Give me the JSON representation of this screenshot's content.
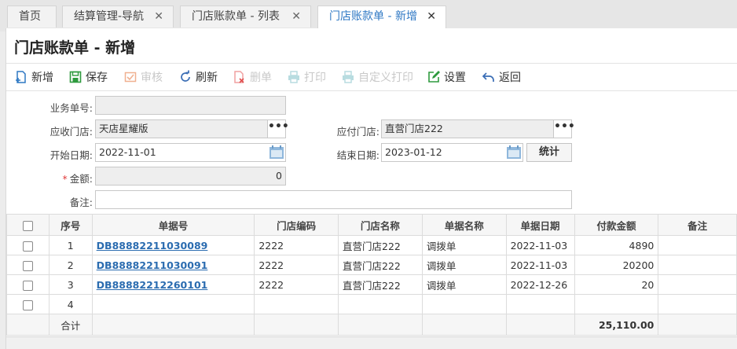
{
  "tabs": [
    {
      "label": "首页",
      "closable": false
    },
    {
      "label": "结算管理-导航",
      "closable": true
    },
    {
      "label": "门店账款单 - 列表",
      "closable": true
    },
    {
      "label": "门店账款单 - 新增",
      "closable": true,
      "active": true
    }
  ],
  "close_glyph": "✕",
  "page_title": "门店账款单 - 新增",
  "toolbar": {
    "add": "新增",
    "save": "保存",
    "audit": "审核",
    "refresh": "刷新",
    "delete": "删单",
    "print": "打印",
    "custom_print": "自定义打印",
    "settings": "设置",
    "back": "返回"
  },
  "form": {
    "business_no_label": "业务单号:",
    "business_no_value": "",
    "receivable_store_label": "应收门店:",
    "receivable_store_value": "天店星耀版",
    "payable_store_label": "应付门店:",
    "payable_store_value": "直营门店222",
    "start_date_label": "开始日期:",
    "start_date_value": "2022-11-01",
    "end_date_label": "结束日期:",
    "end_date_value": "2023-01-12",
    "stats_button": "统计",
    "amount_required": "*",
    "amount_label": "金额:",
    "amount_value": "0",
    "remark_label": "备注:",
    "remark_value": "",
    "lookup_glyph": "•••"
  },
  "table": {
    "headers": {
      "seq": "序号",
      "doc_no": "单据号",
      "store_code": "门店编码",
      "store_name": "门店名称",
      "doc_name": "单据名称",
      "doc_date": "单据日期",
      "pay_amount": "付款金额",
      "remark": "备注"
    },
    "rows": [
      {
        "seq": "1",
        "doc_no": "DB88882211030089",
        "store_code": "2222",
        "store_name": "直营门店222",
        "doc_name": "调拨单",
        "doc_date": "2022-11-03",
        "pay_amount": "4890",
        "remark": ""
      },
      {
        "seq": "2",
        "doc_no": "DB88882211030091",
        "store_code": "2222",
        "store_name": "直营门店222",
        "doc_name": "调拨单",
        "doc_date": "2022-11-03",
        "pay_amount": "20200",
        "remark": ""
      },
      {
        "seq": "3",
        "doc_no": "DB88882212260101",
        "store_code": "2222",
        "store_name": "直营门店222",
        "doc_name": "调拨单",
        "doc_date": "2022-12-26",
        "pay_amount": "20",
        "remark": ""
      },
      {
        "seq": "4",
        "doc_no": "",
        "store_code": "",
        "store_name": "",
        "doc_name": "",
        "doc_date": "",
        "pay_amount": "",
        "remark": ""
      }
    ],
    "total_label": "合计",
    "total_amount": "25,110.00"
  },
  "colors": {
    "accent": "#2f78c4",
    "link": "#2b6cb0",
    "required": "#e03a3a",
    "disabled": "#c9c9c9"
  }
}
